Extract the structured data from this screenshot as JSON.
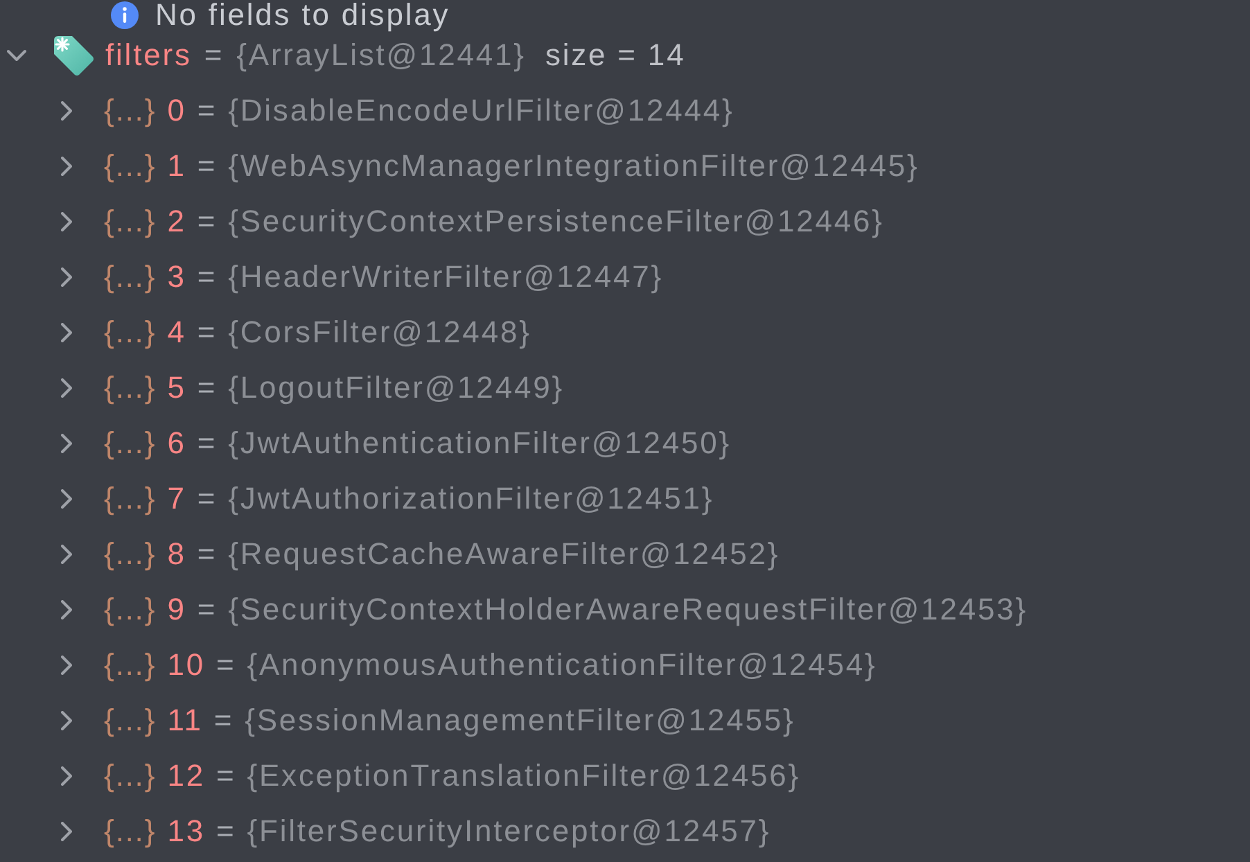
{
  "info_row": {
    "text": "No fields to display"
  },
  "variable": {
    "name": "filters",
    "equals": "=",
    "value": "{ArrayList@12441}",
    "size": "size = 14",
    "expanded": true,
    "children": [
      {
        "badge": "{…}",
        "index": "0",
        "equals": "=",
        "value": "{DisableEncodeUrlFilter@12444}",
        "expanded": false
      },
      {
        "badge": "{…}",
        "index": "1",
        "equals": "=",
        "value": "{WebAsyncManagerIntegrationFilter@12445}",
        "expanded": false
      },
      {
        "badge": "{…}",
        "index": "2",
        "equals": "=",
        "value": "{SecurityContextPersistenceFilter@12446}",
        "expanded": false
      },
      {
        "badge": "{…}",
        "index": "3",
        "equals": "=",
        "value": "{HeaderWriterFilter@12447}",
        "expanded": false
      },
      {
        "badge": "{…}",
        "index": "4",
        "equals": "=",
        "value": "{CorsFilter@12448}",
        "expanded": false
      },
      {
        "badge": "{…}",
        "index": "5",
        "equals": "=",
        "value": "{LogoutFilter@12449}",
        "expanded": false
      },
      {
        "badge": "{…}",
        "index": "6",
        "equals": "=",
        "value": "{JwtAuthenticationFilter@12450}",
        "expanded": false
      },
      {
        "badge": "{…}",
        "index": "7",
        "equals": "=",
        "value": "{JwtAuthorizationFilter@12451}",
        "expanded": false
      },
      {
        "badge": "{…}",
        "index": "8",
        "equals": "=",
        "value": "{RequestCacheAwareFilter@12452}",
        "expanded": false
      },
      {
        "badge": "{…}",
        "index": "9",
        "equals": "=",
        "value": "{SecurityContextHolderAwareRequestFilter@12453}",
        "expanded": false
      },
      {
        "badge": "{…}",
        "index": "10",
        "equals": "=",
        "value": "{AnonymousAuthenticationFilter@12454}",
        "expanded": false
      },
      {
        "badge": "{…}",
        "index": "11",
        "equals": "=",
        "value": "{SessionManagementFilter@12455}",
        "expanded": false
      },
      {
        "badge": "{…}",
        "index": "12",
        "equals": "=",
        "value": "{ExceptionTranslationFilter@12456}",
        "expanded": false
      },
      {
        "badge": "{…}",
        "index": "13",
        "equals": "=",
        "value": "{FilterSecurityInterceptor@12457}",
        "expanded": false
      }
    ]
  }
}
